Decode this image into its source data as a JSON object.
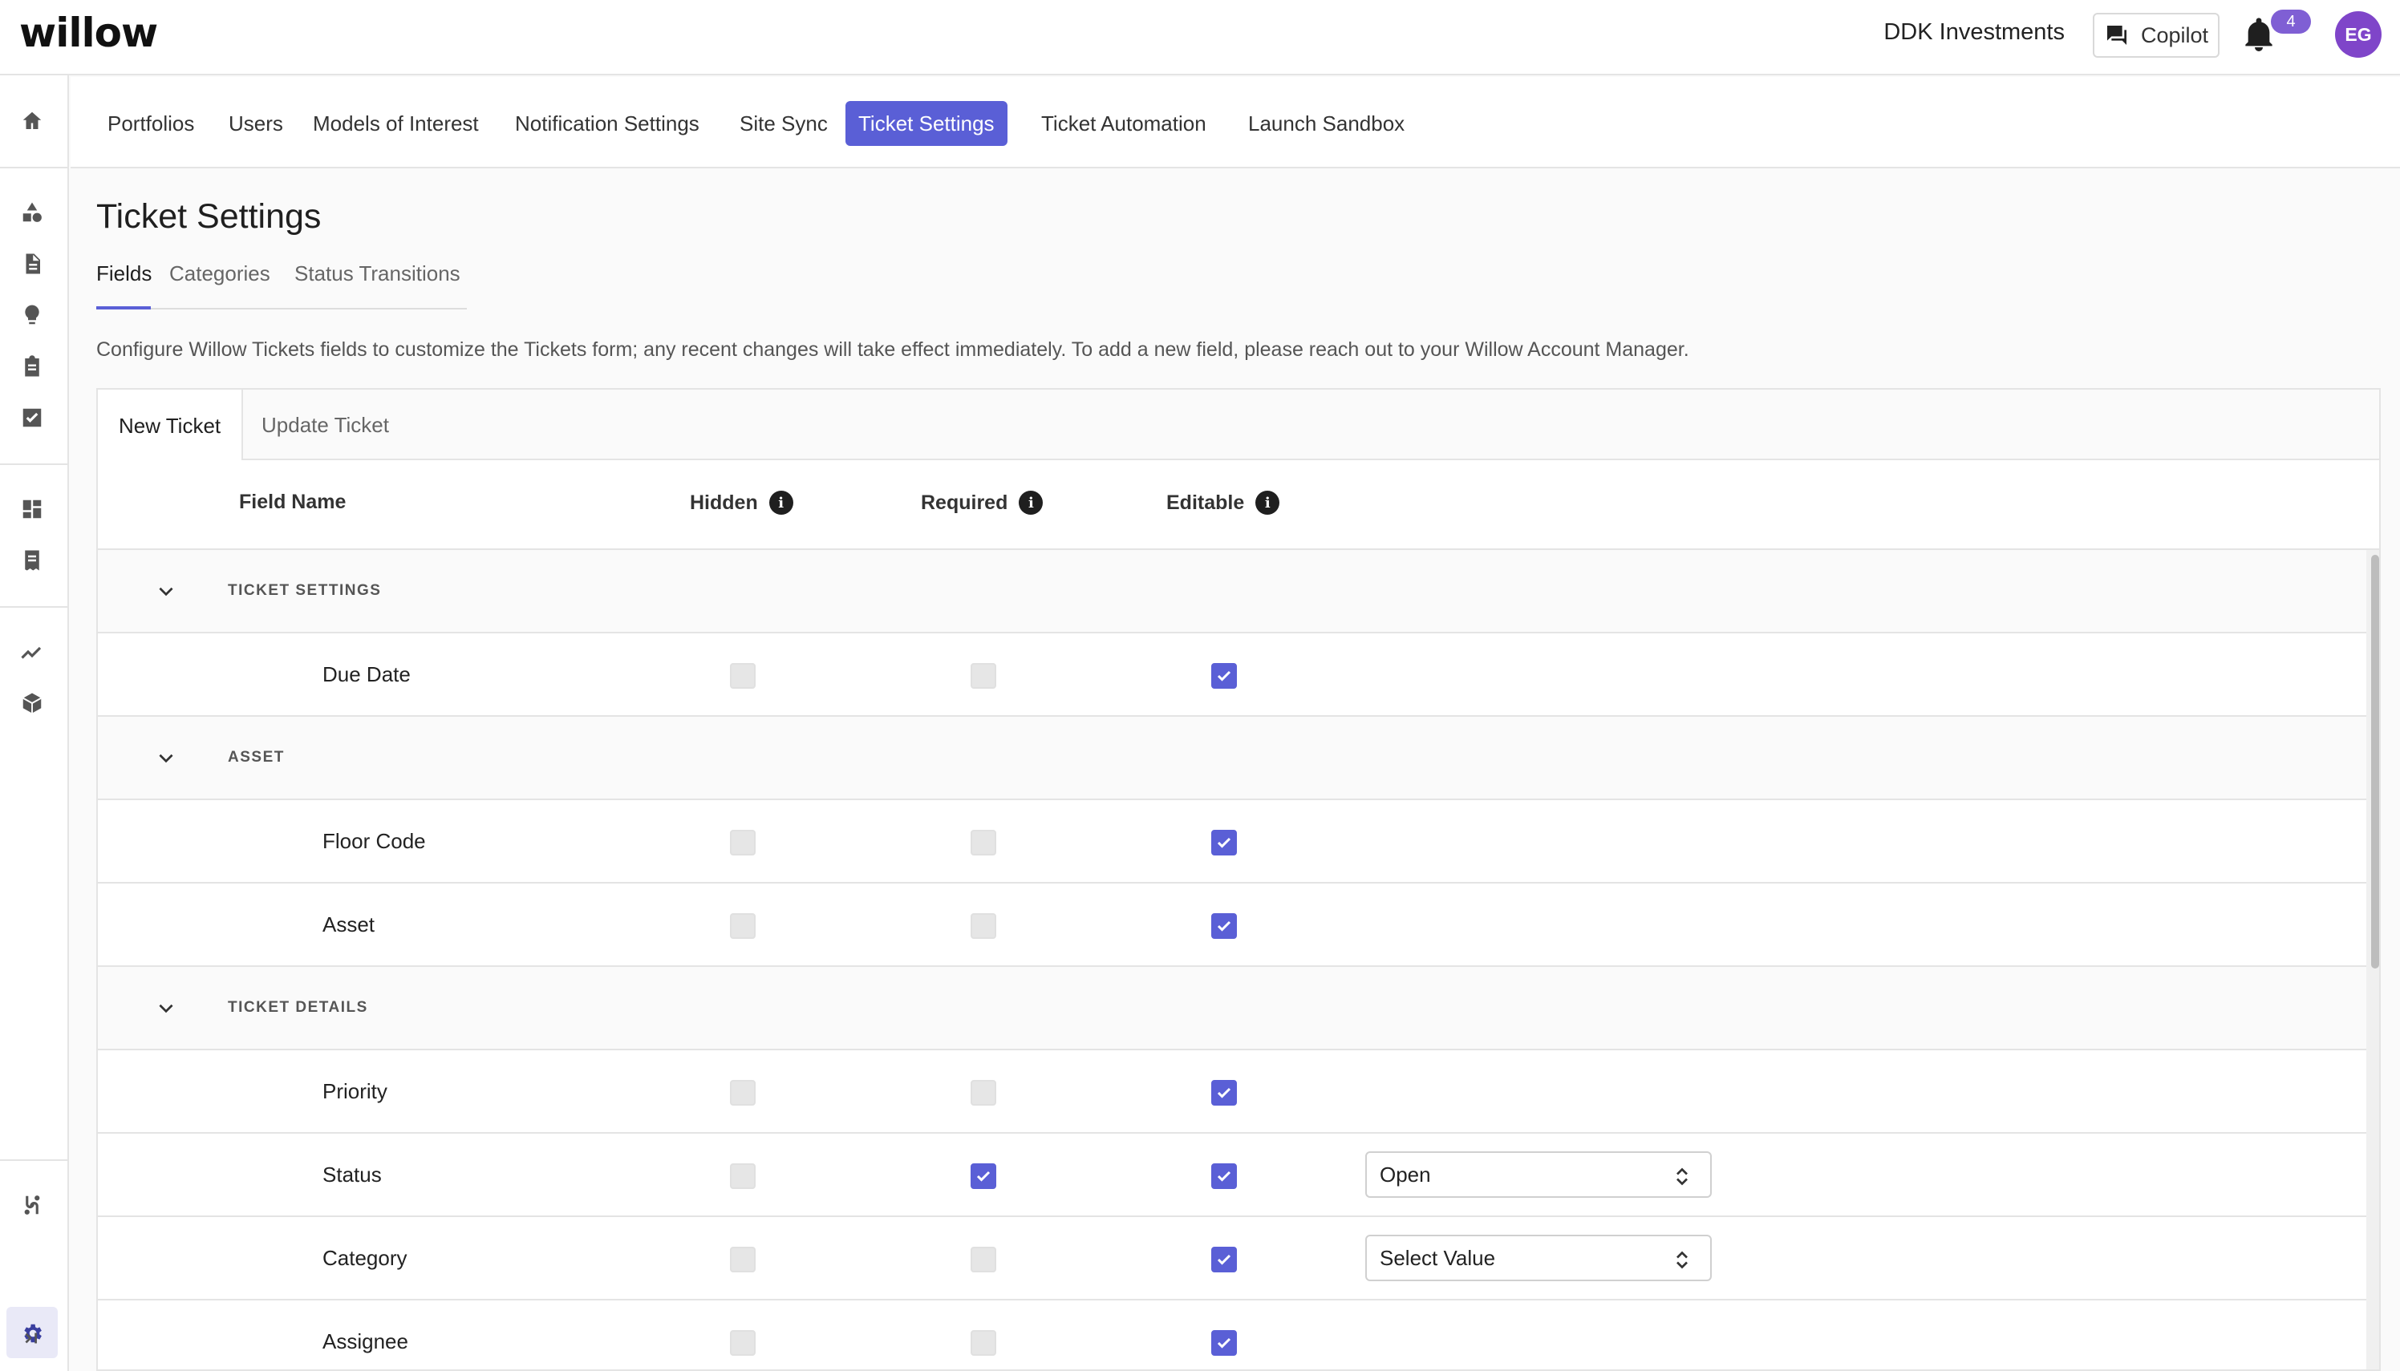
{
  "app": {
    "logo": "willow",
    "org_name": "DDK Investments",
    "copilot_label": "Copilot",
    "notification_count": "4",
    "user_initials": "EG"
  },
  "sidebar": {
    "icons": [
      "home-icon",
      "shapes-icon",
      "document-icon",
      "lightbulb-icon",
      "clipboard-icon",
      "checkbox-icon",
      "dashboard-icon",
      "report-icon",
      "trend-icon",
      "cube-icon",
      "connectors-icon",
      "gear-icon",
      "expand-icon"
    ]
  },
  "nav": {
    "items": [
      "Portfolios",
      "Users",
      "Models of Interest",
      "Notification Settings",
      "Site Sync",
      "Ticket Settings",
      "Ticket Automation",
      "Launch Sandbox"
    ],
    "active": "Ticket Settings"
  },
  "page": {
    "title": "Ticket Settings",
    "subtabs": [
      "Fields",
      "Categories",
      "Status Transitions"
    ],
    "active_subtab": "Fields",
    "description": "Configure Willow Tickets fields to customize the Tickets form; any recent changes will take effect immediately. To add a new field, please reach out to your Willow Account Manager."
  },
  "panel": {
    "tabs": [
      "New Ticket",
      "Update Ticket"
    ],
    "active_tab": "New Ticket",
    "columns": {
      "field_name": "Field Name",
      "hidden": "Hidden",
      "required": "Required",
      "editable": "Editable"
    },
    "info_glyph": "i",
    "groups": [
      {
        "label": "TICKET SETTINGS",
        "fields": [
          {
            "name": "Due Date",
            "hidden": false,
            "required": false,
            "editable": true
          }
        ]
      },
      {
        "label": "ASSET",
        "fields": [
          {
            "name": "Floor Code",
            "hidden": false,
            "required": false,
            "editable": true
          },
          {
            "name": "Asset",
            "hidden": false,
            "required": false,
            "editable": true
          }
        ]
      },
      {
        "label": "TICKET DETAILS",
        "fields": [
          {
            "name": "Priority",
            "hidden": false,
            "required": false,
            "editable": true
          },
          {
            "name": "Status",
            "hidden": false,
            "required": true,
            "editable": true,
            "default_value": "Open"
          },
          {
            "name": "Category",
            "hidden": false,
            "required": false,
            "editable": true,
            "default_value": "Select Value"
          },
          {
            "name": "Assignee",
            "hidden": false,
            "required": false,
            "editable": true
          }
        ]
      }
    ]
  },
  "colors": {
    "accent": "#5a5fd6",
    "avatar": "#7f45c9",
    "badge": "#7f5fd4"
  }
}
